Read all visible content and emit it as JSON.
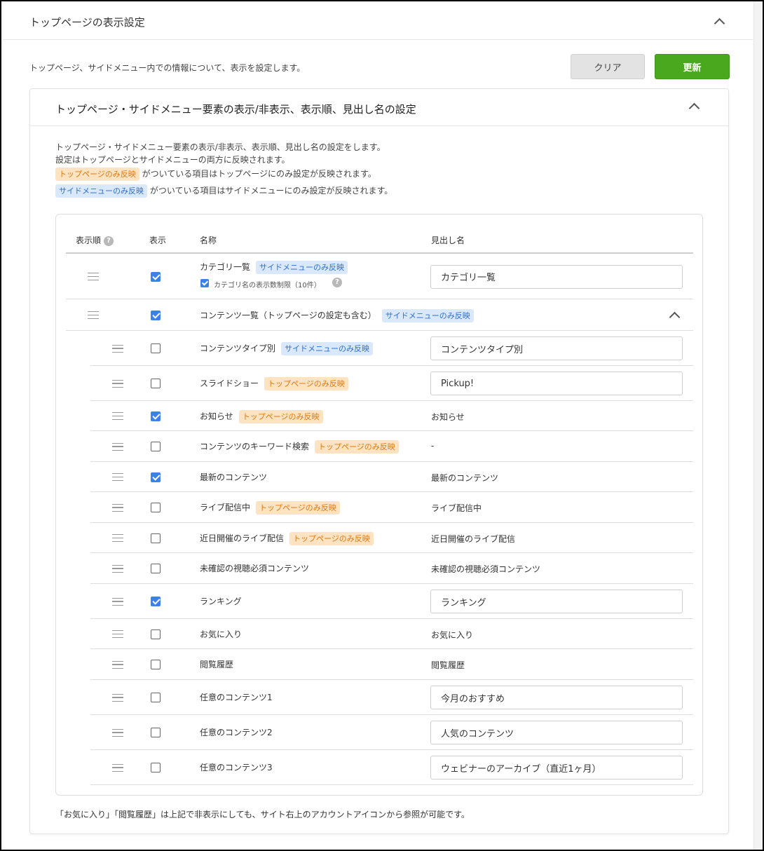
{
  "page": {
    "section_title": "トップページの表示設定",
    "description": "トップページ、サイドメニュー内での情報について、表示を設定します。",
    "clear_label": "クリア",
    "update_label": "更新"
  },
  "card": {
    "title": "トップページ・サイドメニュー要素の表示/非表示、表示順、見出し名の設定",
    "info_line1": "トップページ・サイドメニュー要素の表示/非表示、表示順、見出し名の設定をします。",
    "info_line2": "設定はトップページとサイドメニューの両方に反映されます。",
    "info_line3_suffix": "がついている項目はトップページにのみ設定が反映されます。",
    "info_line4_suffix": "がついている項目はサイドメニューにのみ設定が反映されます。",
    "tag_top": "トップページのみ反映",
    "tag_side": "サイドメニューのみ反映",
    "footnote": "「お気に入り」「閲覧履歴」は上記で非表示にしても、サイト右上のアカウントアイコンから参照が可能です。"
  },
  "table": {
    "col_order": "表示順",
    "col_display": "表示",
    "col_name": "名称",
    "col_heading": "見出し名",
    "help_glyph": "?",
    "rows": [
      {
        "name": "カテゴリ一覧",
        "tag": "サイドメニューのみ反映",
        "checked": true,
        "heading_input": "カテゴリ一覧",
        "sub_label": "カテゴリ名の表示数制限（10件）",
        "sub_checked": true
      },
      {
        "name": "コンテンツ一覧（トップページの設定も含む）",
        "tag": "サイドメニューのみ反映",
        "checked": true
      },
      {
        "name": "コンテンツタイプ別",
        "tag": "サイドメニューのみ反映",
        "checked": false,
        "heading_input": "コンテンツタイプ別"
      },
      {
        "name": "スライドショー",
        "tag": "トップページのみ反映",
        "checked": false,
        "heading_input": "Pickup!"
      },
      {
        "name": "お知らせ",
        "tag": "トップページのみ反映",
        "checked": true,
        "heading_text": "お知らせ"
      },
      {
        "name": "コンテンツのキーワード検索",
        "tag": "トップページのみ反映",
        "checked": false,
        "heading_text": "-"
      },
      {
        "name": "最新のコンテンツ",
        "checked": true,
        "heading_text": "最新のコンテンツ"
      },
      {
        "name": "ライブ配信中",
        "tag": "トップページのみ反映",
        "checked": false,
        "heading_text": "ライブ配信中"
      },
      {
        "name": "近日開催のライブ配信",
        "tag": "トップページのみ反映",
        "checked": false,
        "heading_text": "近日開催のライブ配信"
      },
      {
        "name": "未確認の視聴必須コンテンツ",
        "checked": false,
        "heading_text": "未確認の視聴必須コンテンツ"
      },
      {
        "name": "ランキング",
        "checked": true,
        "heading_input": "ランキング"
      },
      {
        "name": "お気に入り",
        "checked": false,
        "heading_text": "お気に入り"
      },
      {
        "name": "閲覧履歴",
        "checked": false,
        "heading_text": "閲覧履歴"
      },
      {
        "name": "任意のコンテンツ1",
        "checked": false,
        "heading_input": "今月のおすすめ"
      },
      {
        "name": "任意のコンテンツ2",
        "checked": false,
        "heading_input": "人気のコンテンツ"
      },
      {
        "name": "任意のコンテンツ3",
        "checked": false,
        "heading_input": "ウェビナーのアーカイブ（直近1ヶ月）"
      }
    ]
  },
  "colors": {
    "accent_blue": "#3b82e8",
    "update_green": "#4aa81f",
    "tag_top_bg": "#fde3c2",
    "tag_top_fg": "#e07a12",
    "tag_side_bg": "#d9e8fb",
    "tag_side_fg": "#2f6fcf"
  }
}
